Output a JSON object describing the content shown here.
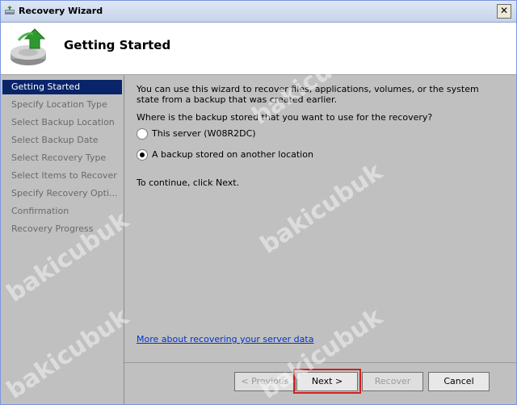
{
  "window": {
    "title": "Recovery Wizard",
    "close_glyph": "✕"
  },
  "header": {
    "title": "Getting Started"
  },
  "nav": {
    "items": [
      {
        "label": "Getting Started"
      },
      {
        "label": "Specify Location Type"
      },
      {
        "label": "Select Backup Location"
      },
      {
        "label": "Select Backup Date"
      },
      {
        "label": "Select Recovery Type"
      },
      {
        "label": "Select Items to Recover"
      },
      {
        "label": "Specify Recovery Opti..."
      },
      {
        "label": "Confirmation"
      },
      {
        "label": "Recovery Progress"
      }
    ]
  },
  "content": {
    "intro": "You can use this wizard to recover files, applications, volumes, or the system state from a backup that was created earlier.",
    "question": "Where is the backup stored that you want to use for the recovery?",
    "option_this_server": "This server (W08R2DC)",
    "option_another_location": "A backup stored on another location",
    "continue_text": "To continue, click Next.",
    "link": "More about recovering your server data"
  },
  "buttons": {
    "previous": "< Previous",
    "next": "Next >",
    "recover": "Recover",
    "cancel": "Cancel"
  },
  "watermark": {
    "text": "bakicubuk"
  },
  "colors": {
    "accent": "#0a246a",
    "highlight": "#d42020"
  }
}
